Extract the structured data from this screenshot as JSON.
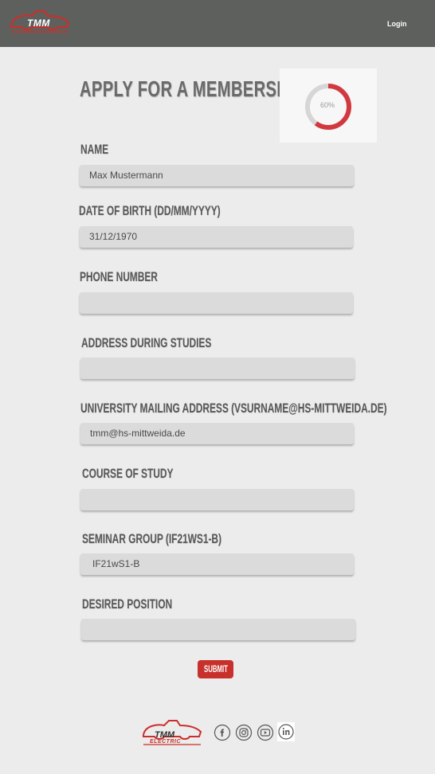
{
  "header": {
    "logo_text": "TMM",
    "login_label": "Login"
  },
  "page": {
    "title": "APPLY FOR A MEMBERSHIP",
    "progress": {
      "value": 0.6,
      "label": "60%"
    }
  },
  "form": {
    "fields": [
      {
        "label": "NAME",
        "value": "Max Mustermann"
      },
      {
        "label": "DATE OF BIRTH (DD/MM/YYYY)",
        "value": "31/12/1970"
      },
      {
        "label": "PHONE NUMBER",
        "value": ""
      },
      {
        "label": "ADDRESS DURING STUDIES",
        "value": ""
      },
      {
        "label": "UNIVERSITY MAILING ADDRESS (VSURNAME@HS-MITTWEIDA.DE)",
        "value": "tmm@hs-mittweida.de"
      },
      {
        "label": "COURSE OF STUDY",
        "value": ""
      },
      {
        "label": "SEMINAR GROUP (IF21WS1-B)",
        "value": "IF21wS1-B"
      },
      {
        "label": "DESIRED POSITION",
        "value": ""
      }
    ],
    "submit_label": "SUBMIT"
  },
  "footer": {
    "logo_text": "TMM",
    "logo_subtext": "ELECTRIC",
    "social": [
      "facebook-icon",
      "instagram-icon",
      "youtube-icon",
      "linkedin-icon"
    ]
  },
  "colors": {
    "header_bg": "#5e605d",
    "accent": "#c8302b",
    "page_bg": "#ececec"
  }
}
